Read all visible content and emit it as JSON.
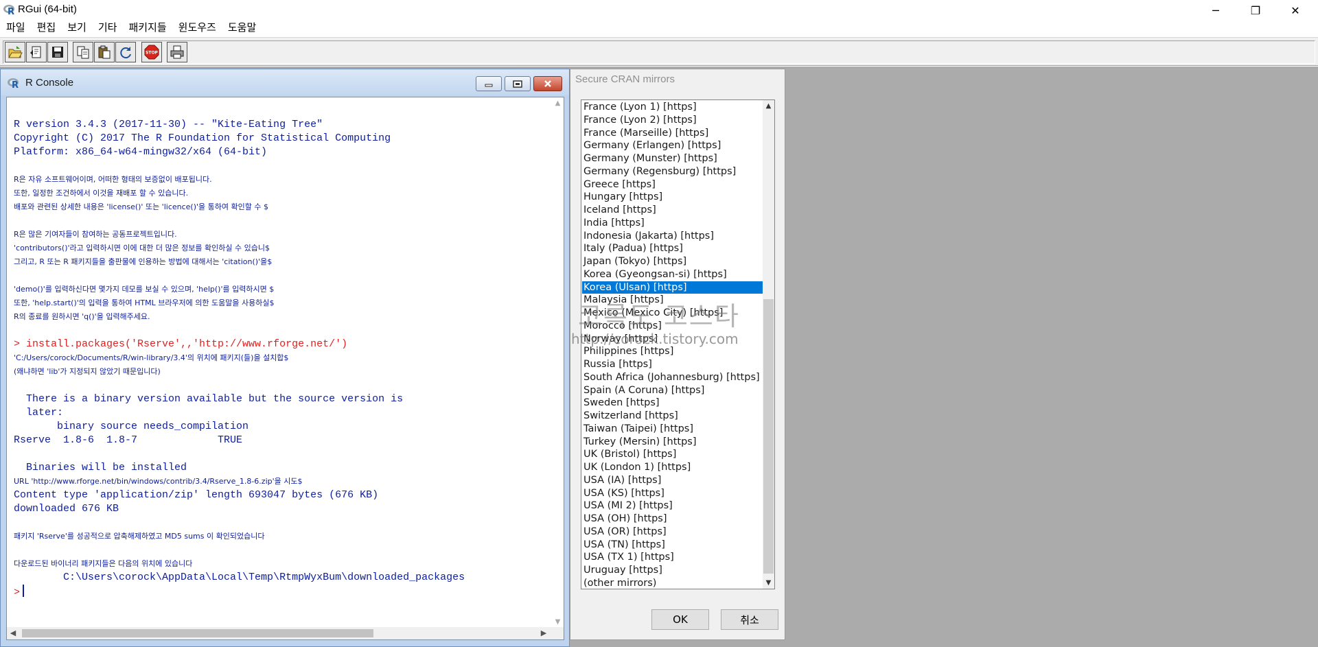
{
  "app": {
    "title": "RGui (64-bit)",
    "window_controls": {
      "minimize": "─",
      "restore": "❐",
      "close": "✕"
    }
  },
  "menu": [
    "파일",
    "편집",
    "보기",
    "기타",
    "패키지들",
    "윈도우즈",
    "도움말"
  ],
  "toolbar": {
    "buttons": [
      "open-script-icon",
      "load-workspace-icon",
      "save-icon",
      "copy-icon",
      "paste-icon",
      "refresh-icon",
      "stop-icon",
      "print-icon"
    ],
    "stop_label": "STOP"
  },
  "console": {
    "title": "R Console",
    "lines": [
      {
        "text": "R version 3.4.3 (2017-11-30) -- \"Kite-Eating Tree\"",
        "style": "mono"
      },
      {
        "text": "Copyright (C) 2017 The R Foundation for Statistical Computing",
        "style": "mono"
      },
      {
        "text": "Platform: x86_64-w64-mingw32/x64 (64-bit)",
        "style": "mono"
      },
      {
        "text": "",
        "style": "gap"
      },
      {
        "text": "R은 자유 소프트웨어이며, 어떠한 형태의 보증없이 배포됩니다.",
        "style": "ko"
      },
      {
        "text": "또한, 일정한 조건하에서 이것을 재배포 할 수 있습니다.",
        "style": "ko"
      },
      {
        "text": "배포와 관련된 상세한 내용은 'license()' 또는 'licence()'을 통하여 확인할 수 $",
        "style": "ko"
      },
      {
        "text": "",
        "style": "gap"
      },
      {
        "text": "R은 많은 기여자들이 참여하는 공동프로젝트입니다.",
        "style": "ko"
      },
      {
        "text": "'contributors()'라고 입력하시면 이에 대한 더 많은 정보를 확인하실 수 있습니$",
        "style": "ko"
      },
      {
        "text": "그리고, R 또는 R 패키지들을 출판물에 인용하는 방법에 대해서는 'citation()'을$",
        "style": "ko"
      },
      {
        "text": "",
        "style": "gap"
      },
      {
        "text": "'demo()'를 입력하신다면 몇가지 데모를 보실 수 있으며, 'help()'를 입력하시면 $",
        "style": "ko"
      },
      {
        "text": "또한, 'help.start()'의 입력을 통하여 HTML 브라우저에 의한 도움말을 사용하실$",
        "style": "ko"
      },
      {
        "text": "R의 종료를 원하시면 'q()'을 입력해주세요.",
        "style": "ko"
      },
      {
        "text": "",
        "style": "gap"
      },
      {
        "text": "> install.packages('Rserve',,'http://www.rforge.net/')",
        "style": "red"
      },
      {
        "text": "'C:/Users/corock/Documents/R/win-library/3.4'의 위치에 패키지(들)을 설치합$",
        "style": "ko"
      },
      {
        "text": "(왜냐하면 'lib'가 지정되지 않았기 때문입니다)",
        "style": "ko"
      },
      {
        "text": "",
        "style": "gap"
      },
      {
        "text": "  There is a binary version available but the source version is",
        "style": "mono"
      },
      {
        "text": "  later:",
        "style": "mono"
      },
      {
        "text": "       binary source needs_compilation",
        "style": "mono"
      },
      {
        "text": "Rserve  1.8-6  1.8-7             TRUE",
        "style": "mono"
      },
      {
        "text": "",
        "style": "gap"
      },
      {
        "text": "  Binaries will be installed",
        "style": "mono"
      },
      {
        "text": "URL 'http://www.rforge.net/bin/windows/contrib/3.4/Rserve_1.8-6.zip'을 시도$",
        "style": "ko"
      },
      {
        "text": "Content type 'application/zip' length 693047 bytes (676 KB)",
        "style": "mono"
      },
      {
        "text": "downloaded 676 KB",
        "style": "mono"
      },
      {
        "text": "",
        "style": "gap"
      },
      {
        "text": "패키지 'Rserve'를 성공적으로 압축해제하였고 MD5 sums 이 확인되었습니다",
        "style": "ko"
      },
      {
        "text": "",
        "style": "gap"
      },
      {
        "text": "다운로드된 바이너리 패키지들은 다음의 위치에 있습니다",
        "style": "ko"
      },
      {
        "text": "        C:\\Users\\corock\\AppData\\Local\\Temp\\RtmpWyxBum\\downloaded_packages",
        "style": "mono"
      }
    ],
    "prompt": ">"
  },
  "cran_dialog": {
    "title": "Secure CRAN mirrors",
    "selected": "Korea (Ulsan) [https]",
    "mirrors": [
      "France (Lyon 1) [https]",
      "France (Lyon 2) [https]",
      "France (Marseille) [https]",
      "Germany (Erlangen) [https]",
      "Germany (Munster) [https]",
      "Germany (Regensburg) [https]",
      "Greece [https]",
      "Hungary [https]",
      "Iceland [https]",
      "India [https]",
      "Indonesia (Jakarta) [https]",
      "Italy (Padua) [https]",
      "Japan (Tokyo) [https]",
      "Korea (Gyeongsan-si) [https]",
      "Korea (Ulsan) [https]",
      "Malaysia [https]",
      "Mexico (Mexico City) [https]",
      "Morocco [https]",
      "Norway [https]",
      "Philippines [https]",
      "Russia [https]",
      "South Africa (Johannesburg) [https]",
      "Spain (A Coruna) [https]",
      "Sweden [https]",
      "Switzerland [https]",
      "Taiwan (Taipei) [https]",
      "Turkey (Mersin) [https]",
      "UK (Bristol) [https]",
      "UK (London 1) [https]",
      "USA (IA) [https]",
      "USA (KS) [https]",
      "USA (MI 2) [https]",
      "USA (OH) [https]",
      "USA (OR) [https]",
      "USA (TN) [https]",
      "USA (TX 1) [https]",
      "Uruguay [https]",
      "(other mirrors)"
    ],
    "ok_label": "OK",
    "cancel_label": "취소"
  },
  "watermark": {
    "line1": "코록도 코스타",
    "line2": "http://corock.tistory.com"
  }
}
